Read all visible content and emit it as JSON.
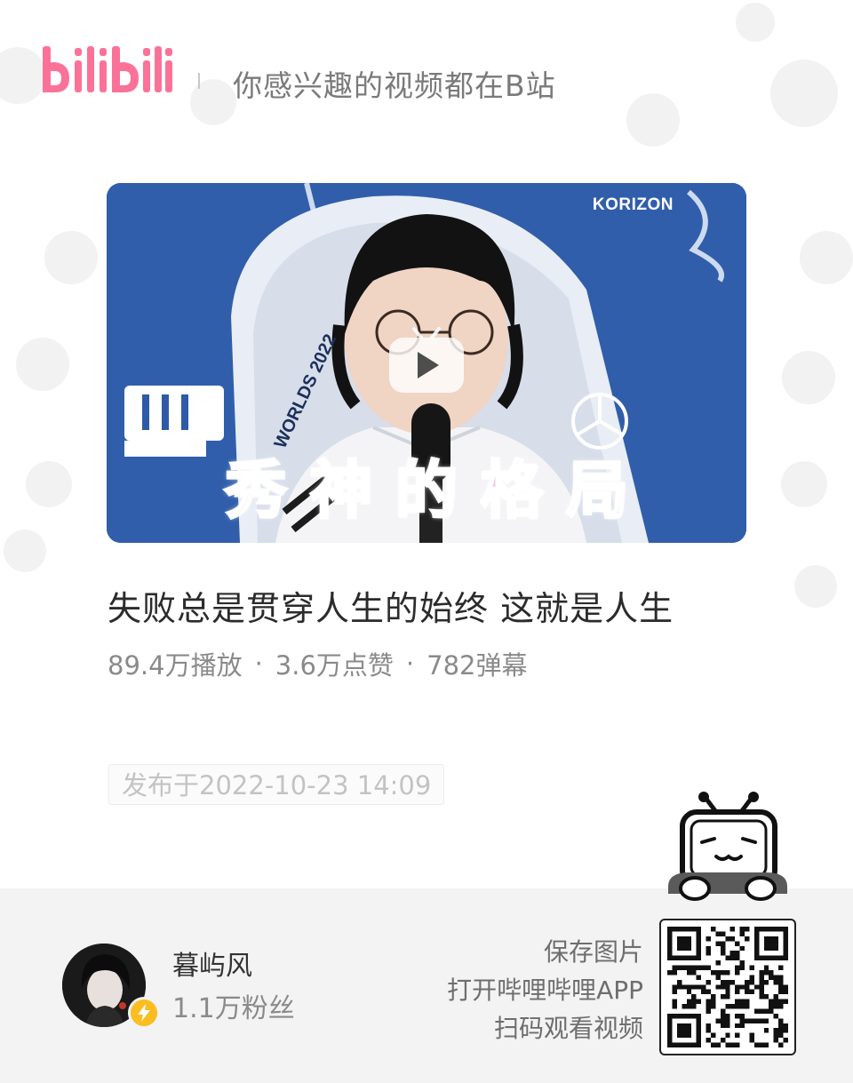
{
  "header": {
    "logo_text": "bilibili",
    "tagline": "你感兴趣的视频都在B站"
  },
  "video": {
    "thumbnail_caption": "秀神的格局",
    "thumbnail_brand": "KORIZON",
    "title": "失败总是贯穿人生的始终 这就是人生",
    "stats": {
      "plays": "89.4万播放",
      "likes": "3.6万点赞",
      "danmaku": "782弹幕",
      "separator": "·"
    },
    "published": "发布于2022-10-23 14:09"
  },
  "uploader": {
    "name": "暮屿风",
    "fans": "1.1万粉丝"
  },
  "share": {
    "lines": [
      "保存图片",
      "打开哔哩哔哩APP",
      "扫码观看视频"
    ]
  },
  "colors": {
    "brand_pink": "#fb7299",
    "thumb_blue": "#2f5aa6",
    "caption_pink": "#f7c6e6",
    "badge_yellow": "#fbbd20"
  },
  "icons": [
    "bilibili-logo",
    "play-icon",
    "lightning-icon",
    "tv-mascot-icon",
    "qr-code"
  ]
}
